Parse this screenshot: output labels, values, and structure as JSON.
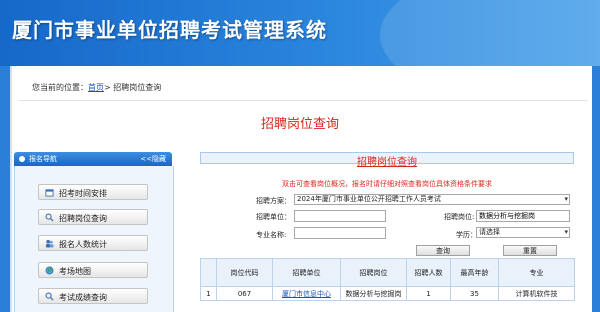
{
  "header": {
    "title": "厦门市事业单位招聘考试管理系统"
  },
  "breadcrumb": {
    "prefix": "您当前的位置：",
    "home": "首页",
    "current": "> 招聘岗位查询"
  },
  "page_title": "招聘岗位查询",
  "sidebar": {
    "title": "报名导航",
    "toggle": "<<隐藏",
    "items": [
      {
        "label": "招考时间安排",
        "icon": "calendar-icon"
      },
      {
        "label": "招聘岗位查询",
        "icon": "search-icon"
      },
      {
        "label": "报名人数统计",
        "icon": "people-icon"
      },
      {
        "label": "考场地图",
        "icon": "map-icon"
      },
      {
        "label": "考试成绩查询",
        "icon": "search-icon"
      }
    ]
  },
  "search_panel": {
    "title": "招聘岗位查询",
    "notice": "双击可查看岗位概况，报名时请仔细对照查看岗位具体资格条件要求",
    "fields": {
      "plan_label": "招聘方案：",
      "plan_value": "2024年厦门市事业单位公开招聘工作人员考试",
      "unit_label": "招聘单位：",
      "unit_value": "",
      "position_label": "招聘岗位:",
      "position_value": "数据分析与挖掘岗",
      "major_label": "专业名称:",
      "major_value": "",
      "edu_label": "学历：",
      "edu_value": "请选择"
    },
    "buttons": {
      "query": "查询",
      "reset": "重置"
    }
  },
  "results": {
    "columns": [
      "",
      "岗位代码",
      "招聘单位",
      "招聘岗位",
      "招聘人数",
      "最高年龄",
      "专业"
    ],
    "rows": [
      [
        "1",
        "067",
        "厦门市信息中心",
        "数据分析与挖掘岗",
        "1",
        "35",
        "计算机软件技"
      ]
    ]
  },
  "colors": {
    "banner": "#1668c9",
    "accent_red": "#d9261c",
    "link_blue": "#1a55b0"
  }
}
